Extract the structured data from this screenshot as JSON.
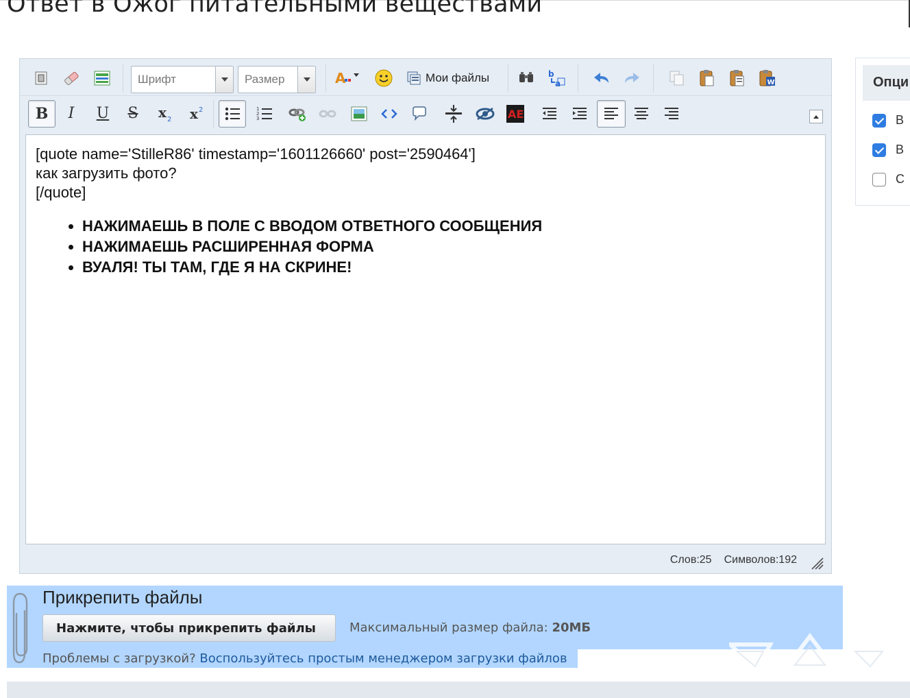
{
  "page": {
    "title": "Ответ в Ожог питательными веществами"
  },
  "toolbar": {
    "font_combo": "Шрифт",
    "size_combo": "Размер",
    "my_files": "Мои файлы",
    "buttons_row1": [
      "source-icon",
      "eraser-icon",
      "template-icon",
      "font-color-icon",
      "emoticon-icon",
      "my-files-icon",
      "find-icon",
      "replace-icon",
      "undo-icon",
      "redo-icon",
      "copy-icon",
      "paste-icon",
      "paste-text-icon",
      "paste-word-icon"
    ],
    "buttons_row2": [
      "bold",
      "italic",
      "underline",
      "strikethrough",
      "subscript",
      "superscript",
      "bulleted-list",
      "numbered-list",
      "link",
      "unlink",
      "image",
      "code",
      "quote",
      "horizontal-rule",
      "spoiler",
      "flash",
      "outdent",
      "indent",
      "align-left",
      "align-center",
      "align-right"
    ],
    "glyphs": {
      "bold": "B",
      "italic": "I",
      "underline": "U",
      "strike": "S",
      "sub": "x",
      "sup": "x"
    }
  },
  "editor": {
    "quote_open": "[quote name='StilleR86' timestamp='1601126660' post='2590464']",
    "quote_text": "как загрузить фото?",
    "quote_close": "[/quote]",
    "list_items": [
      "НАЖИМАЕШЬ В ПОЛЕ С ВВОДОМ ОТВЕТНОГО СООБЩЕНИЯ",
      "НАЖИМАЕШЬ РАСШИРЕННАЯ ФОРМА",
      "ВУАЛЯ! ТЫ ТАМ, ГДЕ Я НА СКРИНЕ!"
    ],
    "words_count": "Слов:25",
    "chars_count": "Символов:192"
  },
  "options": {
    "title": "Опци",
    "items": [
      {
        "label": "В",
        "checked": true
      },
      {
        "label": "В",
        "checked": true
      },
      {
        "label": "С",
        "checked": false
      }
    ]
  },
  "attachments": {
    "title": "Прикрепить файлы",
    "button_label": "Нажмите, чтобы прикрепить файлы",
    "max_size_label": "Максимальный размер файла:",
    "max_size_value": "20МБ",
    "problems_text": "Проблемы с загрузкой?",
    "simple_manager_link": "Воспользуйтесь простым менеджером загрузки файлов"
  },
  "colors": {
    "selection": "#b2d6ff",
    "toolbar_bg": "#e6edf5",
    "link": "#1e5a9c",
    "checkbox_on": "#2f7de1"
  }
}
